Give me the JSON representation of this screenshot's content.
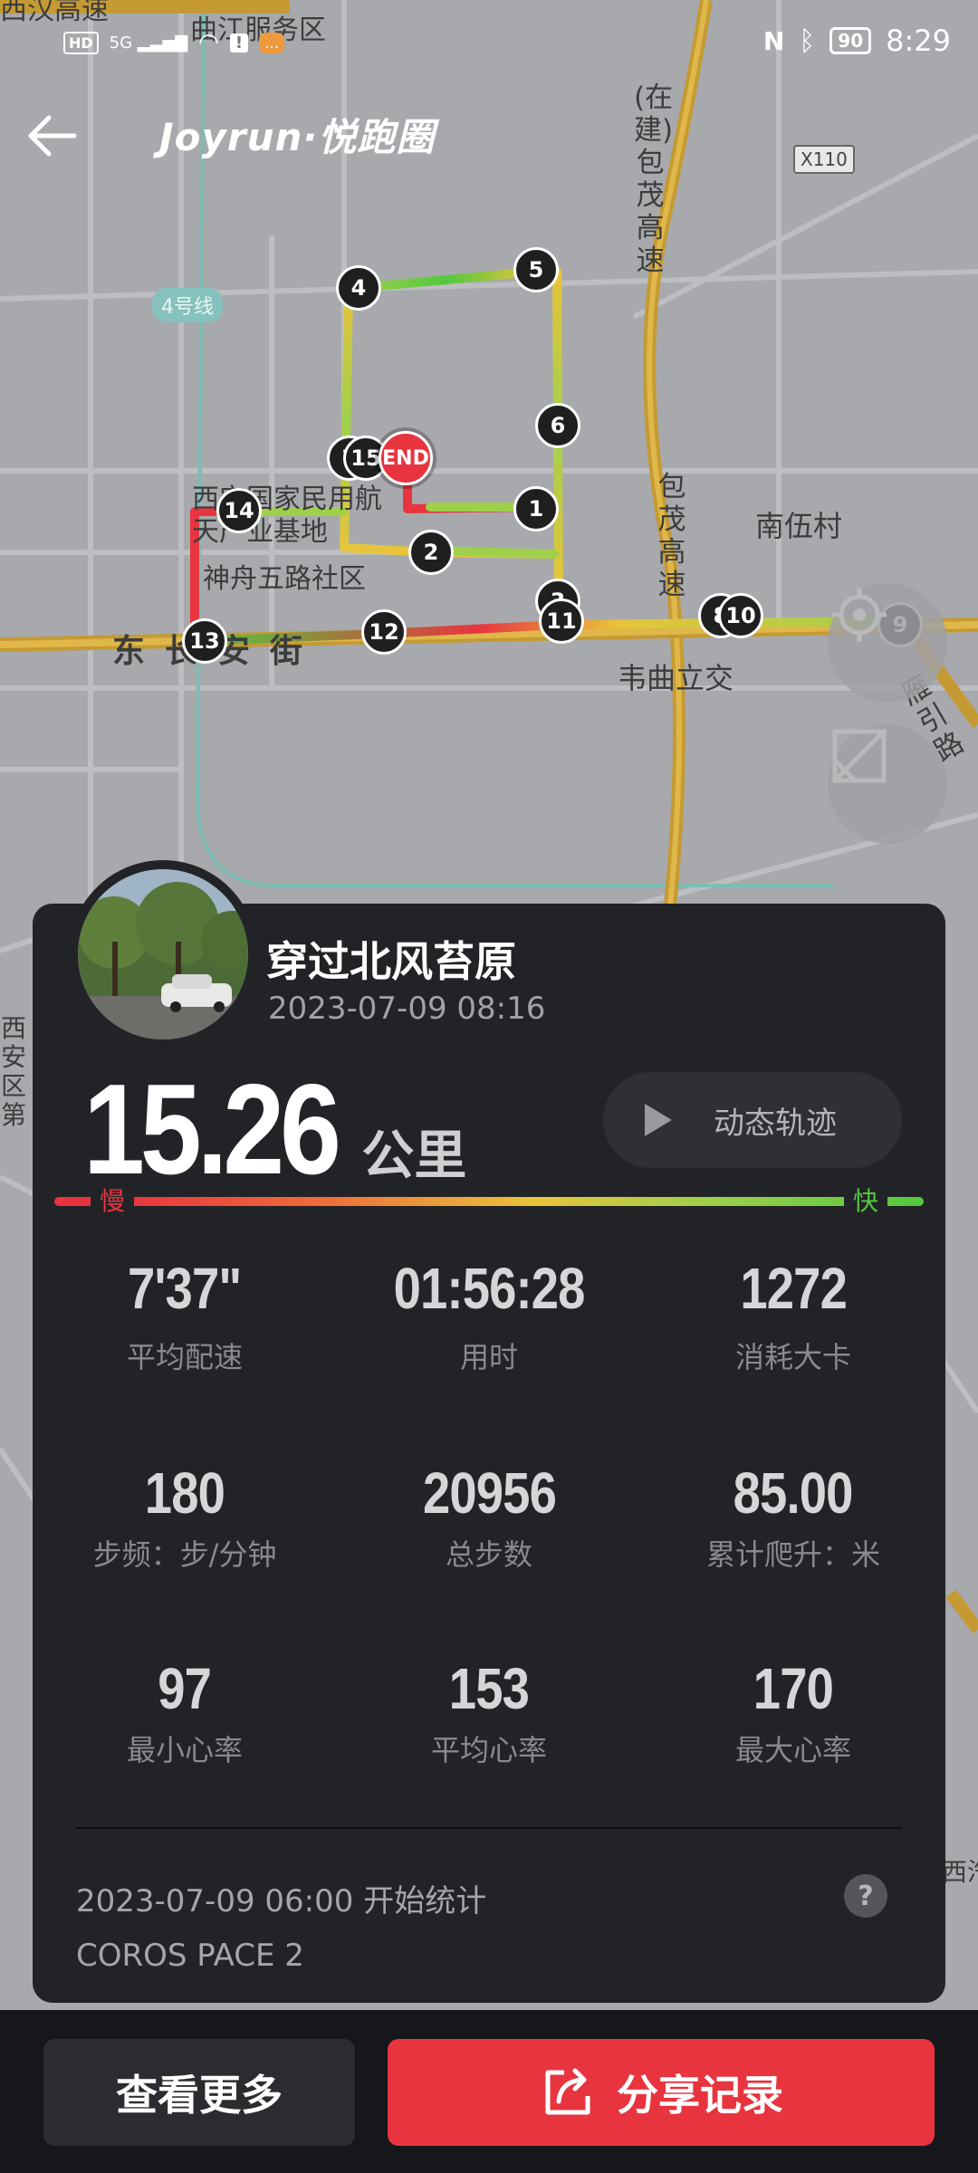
{
  "status_bar": {
    "network": "5G",
    "time": "8:29",
    "battery": "90",
    "icons": [
      "hd-icon",
      "signal-icon",
      "wifi-icon",
      "alert-icon",
      "message-icon",
      "nfc-icon",
      "bluetooth-icon",
      "battery-icon"
    ]
  },
  "header": {
    "logo": "Joyrun·悦跑圈",
    "back_icon": "arrow-left-icon"
  },
  "map": {
    "labels": {
      "top_area": "曲江服务区",
      "top_left": "西汉高速",
      "metro_line": "4号线",
      "road_x110": "X110",
      "expressway_1": "(在建)包茂高速",
      "expressway_2": "包茂高速",
      "village": "南伍村",
      "industrial_base": "西安国家民用航天产业基地",
      "community": "神舟五路社区",
      "street": "东长安街",
      "interchange": "韦曲立交",
      "road_right": "雁引路",
      "left_edge": "西安区第",
      "right_edge": "西汽"
    },
    "markers": [
      "1",
      "2",
      "3",
      "4",
      "5",
      "6",
      "7",
      "8",
      "9",
      "10",
      "11",
      "12",
      "13",
      "14",
      "15"
    ],
    "end_label": "END"
  },
  "run": {
    "name": "穿过北风苔原",
    "date": "2023-07-09 08:16",
    "distance": "15.26",
    "distance_unit": "公里",
    "track_button": "动态轨迹",
    "pace_slow": "慢",
    "pace_fast": "快"
  },
  "stats": [
    {
      "value": "7'37\"",
      "label": "平均配速"
    },
    {
      "value": "01:56:28",
      "label": "用时"
    },
    {
      "value": "1272",
      "label": "消耗大卡"
    },
    {
      "value": "180",
      "label": "步频：步/分钟"
    },
    {
      "value": "20956",
      "label": "总步数"
    },
    {
      "value": "85.00",
      "label": "累计爬升：米"
    },
    {
      "value": "97",
      "label": "最小心率"
    },
    {
      "value": "153",
      "label": "平均心率"
    },
    {
      "value": "170",
      "label": "最大心率"
    }
  ],
  "footer": {
    "stat_start": "2023-07-09 06:00  开始统计",
    "device": "COROS PACE 2",
    "help": "?"
  },
  "actions": {
    "more": "查看更多",
    "share": "分享记录"
  }
}
